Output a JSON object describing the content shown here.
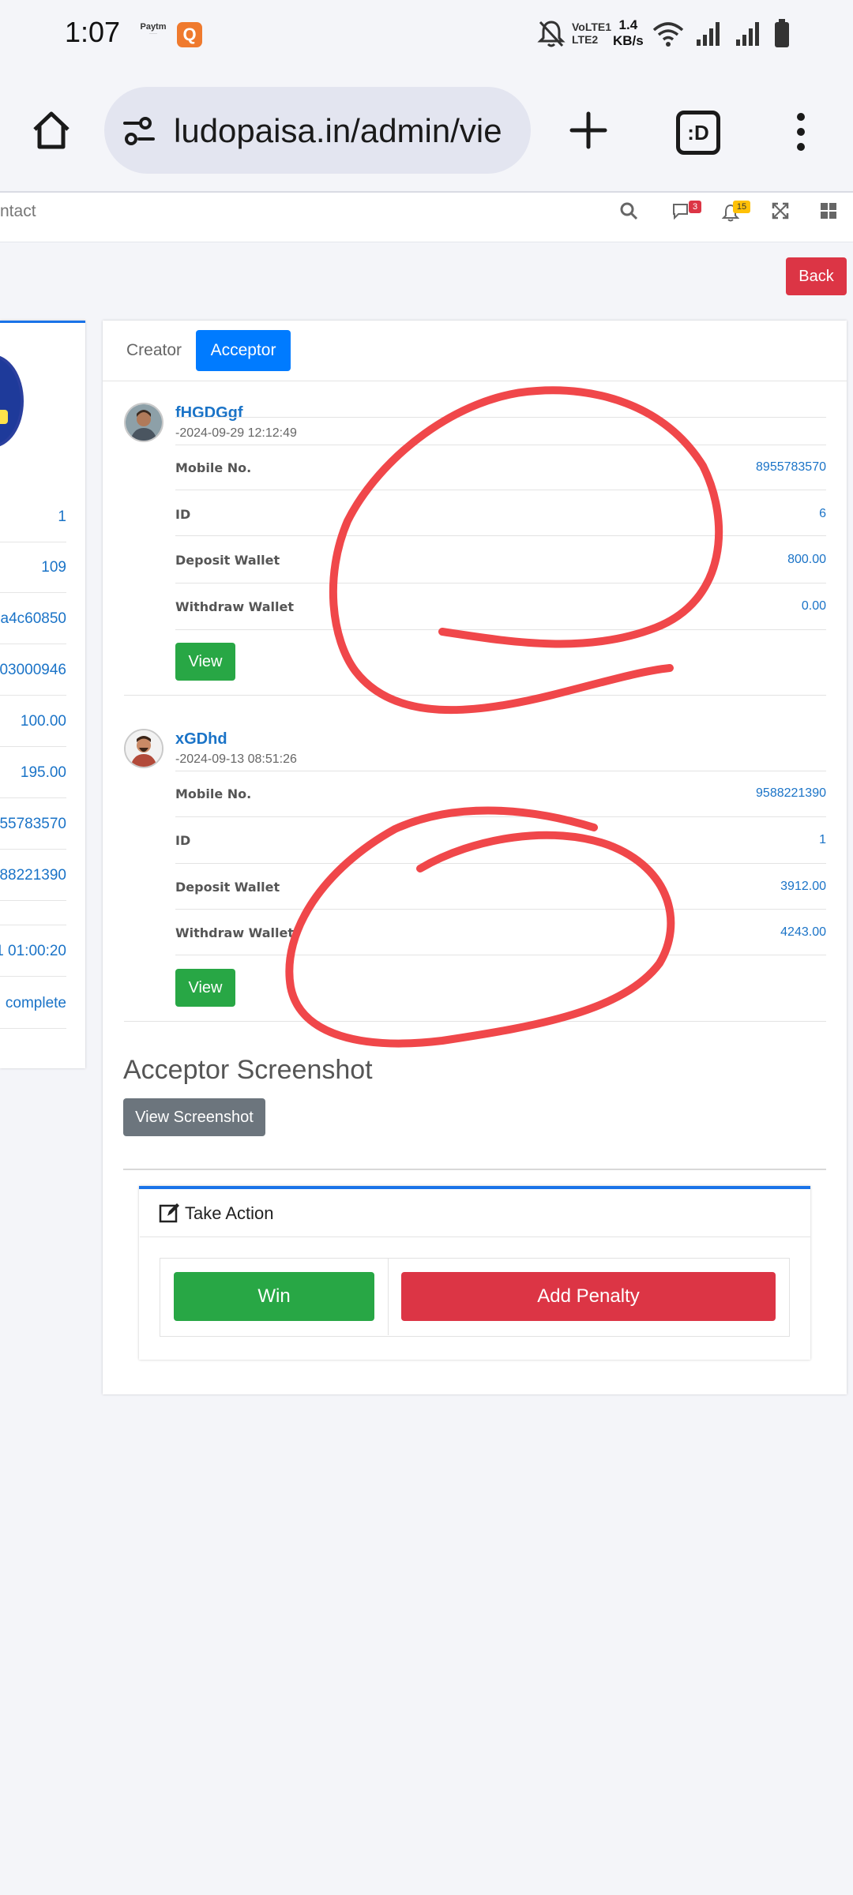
{
  "status_bar": {
    "time": "1:07",
    "paytm_label": "Paytm",
    "app_badge": "Q",
    "network_label_1": "VoLTE1",
    "network_label_2": "LTE2",
    "speed_value": "1.4",
    "speed_unit": "KB/s",
    "icons": [
      "paytm-icon",
      "q-app-icon",
      "mute-icon",
      "wifi-icon",
      "signal-icon",
      "battery-icon"
    ]
  },
  "browser": {
    "url": "ludopaisa.in/admin/vie",
    "tab_count_label": ":D",
    "icons": [
      "home-icon",
      "site-settings-icon",
      "new-tab-icon",
      "tabs-icon",
      "more-icon"
    ]
  },
  "navbar": {
    "link_text": "ntact",
    "chat_badge": "3",
    "notif_badge": "15",
    "icons": [
      "search-icon",
      "chat-icon",
      "bell-icon",
      "fullscreen-icon",
      "grid-icon"
    ]
  },
  "back_button": "Back",
  "left_card": {
    "rows": [
      "1",
      "109",
      "a4c60850",
      "03000946",
      "100.00",
      "195.00",
      "55783570",
      "88221390",
      "1 01:00:20",
      "complete"
    ]
  },
  "tabs": {
    "creator": "Creator",
    "acceptor": "Acceptor"
  },
  "players": [
    {
      "name": "fHGDGgf",
      "date": "-2024-09-29 12:12:49",
      "fields": [
        {
          "label": "Mobile No.",
          "value": "8955783570"
        },
        {
          "label": "ID",
          "value": "6"
        },
        {
          "label": "Deposit Wallet",
          "value": "800.00"
        },
        {
          "label": "Withdraw Wallet",
          "value": "0.00"
        }
      ],
      "view_label": "View"
    },
    {
      "name": "xGDhd",
      "date": "-2024-09-13 08:51:26",
      "fields": [
        {
          "label": "Mobile No.",
          "value": "9588221390"
        },
        {
          "label": "ID",
          "value": "1"
        },
        {
          "label": "Deposit Wallet",
          "value": "3912.00"
        },
        {
          "label": "Withdraw Wallet",
          "value": "4243.00"
        }
      ],
      "view_label": "View"
    }
  ],
  "screenshot_section": {
    "title": "Acceptor Screenshot",
    "button_label": "View Screenshot"
  },
  "action_panel": {
    "title": "Take Action",
    "win_label": "Win",
    "penalty_label": "Add Penalty"
  },
  "colors": {
    "primary": "#007bff",
    "success": "#28a745",
    "danger": "#dc3545",
    "secondary": "#6c757d",
    "link": "#1a73c7",
    "annotation": "#f0474a"
  }
}
